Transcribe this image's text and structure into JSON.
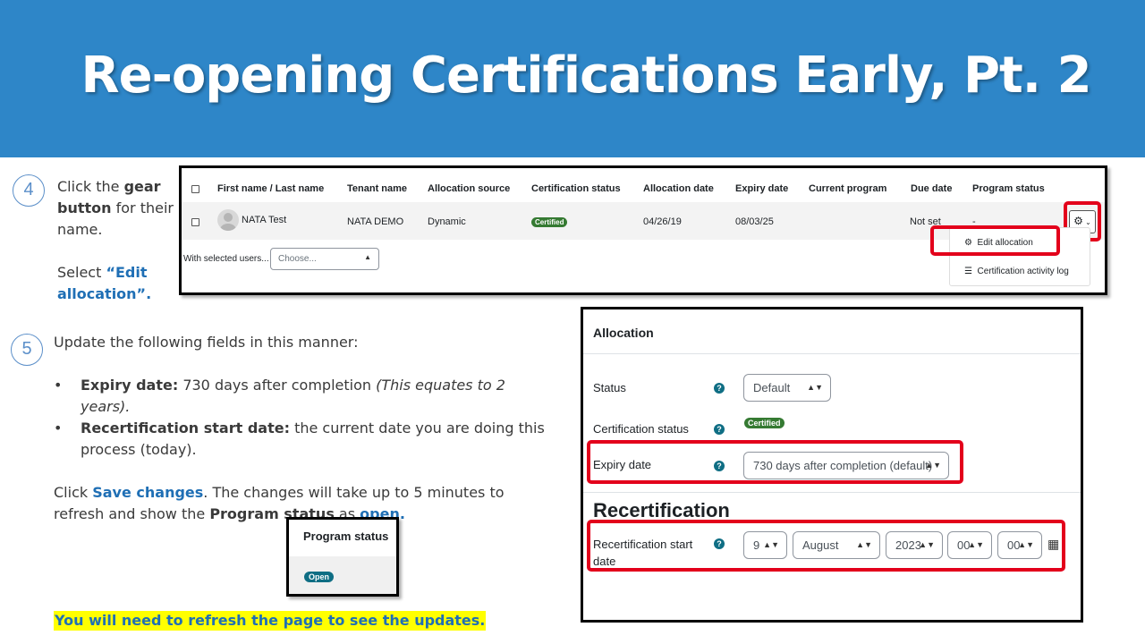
{
  "banner": {
    "title": "Re-opening Certifications Early, Pt. 2"
  },
  "step4": {
    "number": "4",
    "t1": "Click the ",
    "t2": "gear",
    "t3": "button",
    "t4": " for their name.",
    "t5": "Select ",
    "t6": "“Edit allocation”."
  },
  "step5": {
    "number": "5",
    "intro": "Update the following fields in this manner:",
    "b1_label": "Expiry date:",
    "b1_text": " 730 days after completion ",
    "b1_italic": "(This equates to 2 years).",
    "b2_label": "Recertification start date:",
    "b2_text": " the current date you are doing this process (today).",
    "p1": "Click ",
    "p2": "Save changes",
    "p3": ". The changes will take up to 5 minutes to refresh and show the ",
    "p4": "Program status",
    "p5": " as ",
    "p6": "open."
  },
  "table": {
    "headers": [
      "First name / Last name",
      "Tenant name",
      "Allocation source",
      "Certification status",
      "Allocation date",
      "Expiry date",
      "Current program",
      "Due date",
      "Program status"
    ],
    "row": {
      "name": "NATA Test",
      "tenant": "NATA DEMO",
      "source": "Dynamic",
      "cert_status": "Certified",
      "alloc_date": "04/26/19",
      "expiry": "08/03/25",
      "due": "Not set",
      "program_status": "-"
    },
    "with_selected": "With selected users...",
    "choose": "Choose...",
    "menu": {
      "edit": "Edit allocation",
      "log": "Certification activity log"
    }
  },
  "form": {
    "section": "Allocation",
    "status_label": "Status",
    "status_value": "Default",
    "cert_status_label": "Certification status",
    "cert_status_value": "Certified",
    "expiry_label": "Expiry date",
    "expiry_value": "730 days after completion (default)",
    "recert_heading": "Recertification",
    "recert_label_1": "Recertification start",
    "recert_label_2": "date",
    "day": "9",
    "month": "August",
    "year": "2023",
    "hour": "00",
    "minute": "00"
  },
  "program_status_box": {
    "header": "Program status",
    "badge": "Open"
  },
  "note": "You will need to refresh the page to see the updates.",
  "colors": {
    "banner": "#2e86c8",
    "highlight_red": "#e3001b",
    "link_blue": "#1f6fb5",
    "certified_green": "#357a32",
    "open_teal": "#0f6e84",
    "note_bg": "#ffff00"
  }
}
